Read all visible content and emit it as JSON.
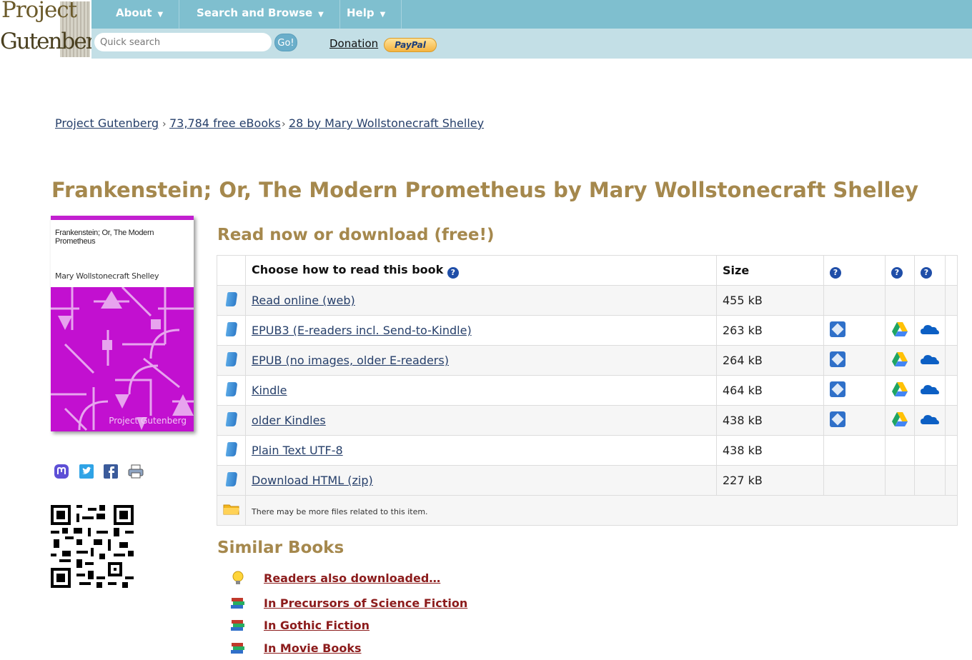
{
  "header": {
    "logo_line1": "Project",
    "logo_line2": "Gutenberg",
    "nav": [
      {
        "label": "About"
      },
      {
        "label": "Search and Browse"
      },
      {
        "label": "Help"
      }
    ],
    "search_placeholder": "Quick search",
    "go_label": "Go!",
    "donation_label": "Donation",
    "paypal_label": "PayPal"
  },
  "breadcrumb": {
    "home": "Project Gutenberg",
    "sep": "›",
    "ebooks": "73,784 free eBooks",
    "author": "28 by Mary Wollstonecraft Shelley"
  },
  "book": {
    "title": "Frankenstein; Or, The Modern Prometheus by Mary Wollstonecraft Shelley",
    "cover_title": "Frankenstein; Or, The Modern Prometheus",
    "cover_author": "Mary Wollstonecraft Shelley",
    "cover_publisher": "Project Gutenberg",
    "cover_color": "#c210d0"
  },
  "download": {
    "heading": "Read now or download (free!)",
    "col_choose": "Choose how to read this book",
    "col_size": "Size",
    "formats": [
      {
        "label": "Read online (web)",
        "size": "455 kB",
        "cloud": false
      },
      {
        "label": "EPUB3 (E-readers incl. Send-to-Kindle)",
        "size": "263 kB",
        "cloud": true
      },
      {
        "label": "EPUB (no images, older E-readers)",
        "size": "264 kB",
        "cloud": true
      },
      {
        "label": "Kindle",
        "size": "464 kB",
        "cloud": true
      },
      {
        "label": "older Kindles",
        "size": "438 kB",
        "cloud": true
      },
      {
        "label": "Plain Text UTF-8",
        "size": "438 kB",
        "cloud": false
      },
      {
        "label": "Download HTML (zip)",
        "size": "227 kB",
        "cloud": false
      }
    ],
    "more_files_note": "There may be more files related to this item."
  },
  "similar": {
    "heading": "Similar Books",
    "items": [
      {
        "label": "Readers also downloaded…",
        "icon": "lightbulb-icon"
      },
      {
        "label": "In Precursors of Science Fiction",
        "icon": "books-icon"
      },
      {
        "label": "In Gothic Fiction",
        "icon": "books-icon"
      },
      {
        "label": "In Movie Books",
        "icon": "books-icon"
      }
    ]
  }
}
